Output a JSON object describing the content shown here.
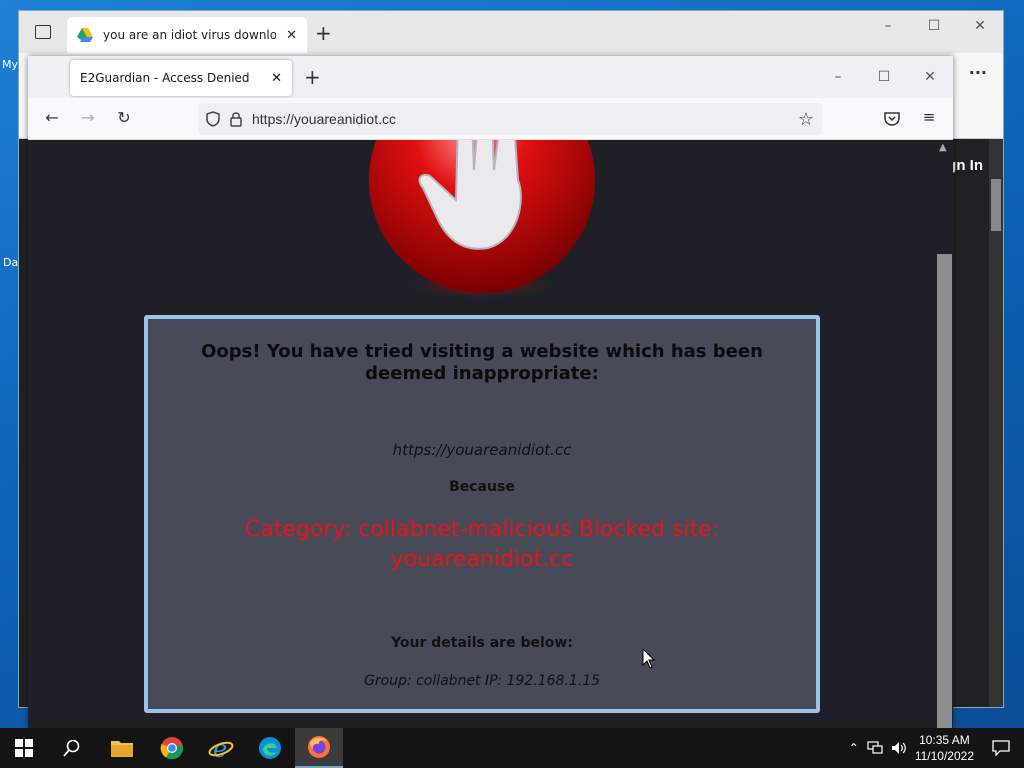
{
  "desktop": {
    "icon_labels": [
      "My",
      "Da"
    ]
  },
  "back_browser": {
    "tab_title": "you are an idiot virus download",
    "menu_glyph": "···",
    "sign_in": "gn In",
    "controls": {
      "minimize": "–",
      "maximize": "☐",
      "close": "✕"
    }
  },
  "front_browser": {
    "tab_title": "E2Guardian - Access Denied",
    "url": "https://youareanidiot.cc",
    "controls": {
      "minimize": "–",
      "maximize": "☐",
      "close": "✕"
    }
  },
  "block_page": {
    "title": "Oops! You have tried visiting a website which has been deemed inappropriate:",
    "blocked_url": "https://youareanidiot.cc",
    "because_label": "Because",
    "reason": "Category: collabnet-malicious  Blocked site: youareanidiot.cc",
    "details_label": "Your details are below:",
    "group_info": "Group: collabnet    IP: 192.168.1.15"
  },
  "taskbar": {
    "apps": [
      "start-button",
      "search",
      "file-explorer",
      "chrome",
      "internet-explorer",
      "edge",
      "firefox"
    ],
    "active_app": "firefox",
    "time": "10:35 AM",
    "date": "11/10/2022"
  },
  "colors": {
    "desktop_bg": "#1f7fd6",
    "page_bg": "#1f2027",
    "panel_bg": "#474a57",
    "panel_border": "#9fc2e8",
    "reason_text": "#e8141a"
  }
}
